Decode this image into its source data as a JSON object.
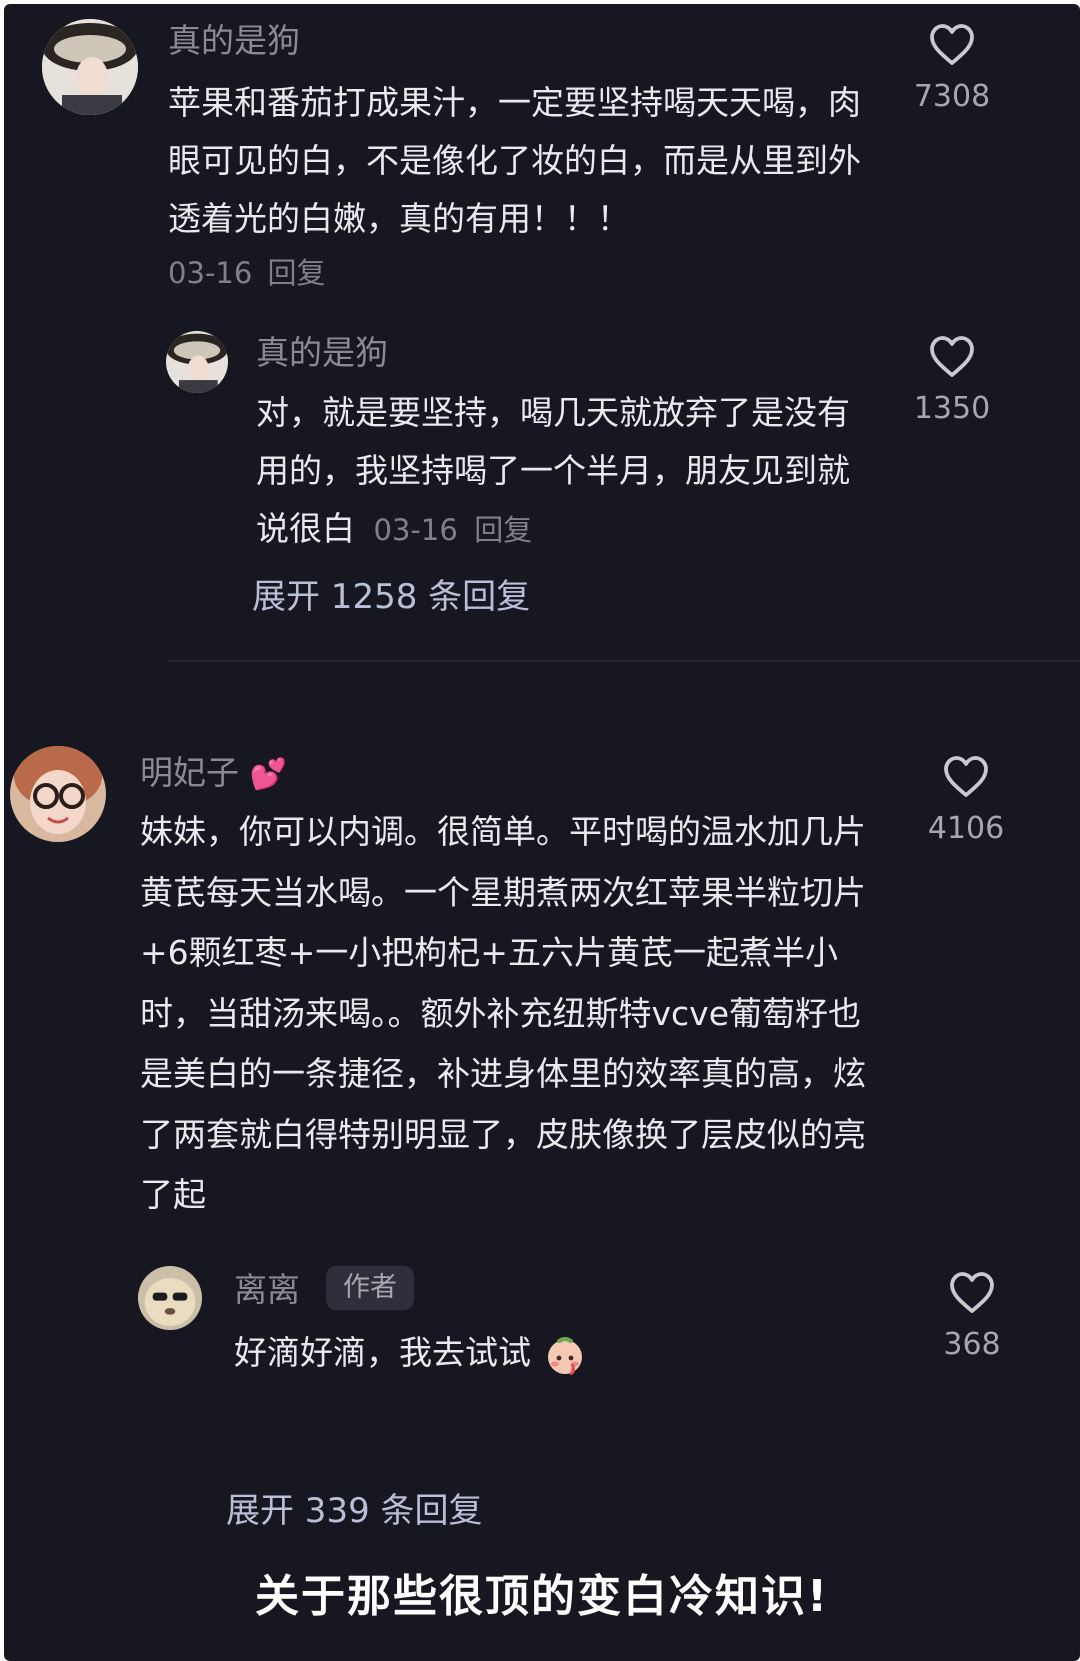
{
  "comments": [
    {
      "username": "真的是狗",
      "text": "苹果和番茄打成果汁，一定要坚持喝天天喝，肉眼可见的白，不是像化了妆的白，而是从里到外透着光的白嫩，真的有用！！！",
      "date": "03-16",
      "reply_label": "回复",
      "likes": "7308",
      "reply": {
        "username": "真的是狗",
        "text": "对，就是要坚持，喝几天就放弃了是没有用的，我坚持喝了一个半月，朋友见到就说很白",
        "date": "03-16",
        "reply_label": "回复",
        "likes": "1350"
      },
      "expand_label": "展开 1258 条回复"
    },
    {
      "username": "明妃子",
      "username_emoji": "💕",
      "text": "妹妹，你可以内调。很简单。平时喝的温水加几片黄芪每天当水喝。一个星期煮两次红苹果半粒切片+6颗红枣+一小把枸杞+五六片黄芪一起煮半小时，当甜汤来喝。。额外补充纽斯特vcve葡萄籽也是美白的一条捷径，补进身体里的效率真的高，炫了两套就白得特别明显了，皮肤像换了层皮似的亮了起",
      "likes": "4106",
      "reply": {
        "username": "离离",
        "badge": "作者",
        "text": "好滴好滴，我去试试",
        "likes": "368"
      },
      "expand_label": "展开 339 条回复"
    }
  ],
  "caption": "关于那些很顶的变白冷知识!",
  "icons": {
    "like": "heart-outline-icon"
  },
  "colors": {
    "background": "#161720",
    "text": "#e9e9ee",
    "muted": "#8a8a93",
    "expand": "#b9bfd6"
  }
}
